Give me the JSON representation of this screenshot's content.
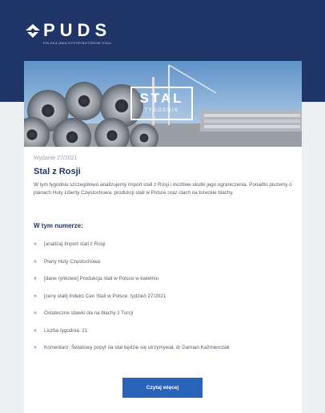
{
  "header": {
    "logo_text": "PUDS",
    "logo_subtitle": "POLSKA UNIA DYSTRYBUTORÓW STALI",
    "background_color": "#1f3467"
  },
  "hero": {
    "badge_main": "STAL",
    "badge_sub": "TYGODNIK"
  },
  "newsletter": {
    "issue": "Wydanie 27/2021",
    "title": "Stal z Rosji",
    "intro": "W tym tygodniu szczegółowo analizujemy import stali z Rosji i możliwe skutki jego ograniczenia. Ponadto piszemy o planach Huty Liberty Częstochowa, produkcji stali w Polsce oraz cłach na tureckie blachy.",
    "contents_heading": "W tym numerze:",
    "items": [
      "[analiza] Import stali z Rosji",
      "Plany Huty Częstochowa",
      "[dane rynkowe] Produkcja stali w Polsce w kwietniu",
      "[ceny stali] Indeks Cen Stali w Polsce: tydzień 27/2021",
      "Ostateczne stawki cła na blachy z Turcji",
      "Liczba tygodnia: 21",
      "Komentarz: Światowy popyt na stal będzie się utrzymywał, dr Damian Kaźmierczak"
    ],
    "bullet_glyph": "»",
    "read_more_label": "Czytaj więcej"
  },
  "colors": {
    "accent": "#2a64b8",
    "navy": "#1f3467",
    "page_background": "#eeeff1"
  }
}
